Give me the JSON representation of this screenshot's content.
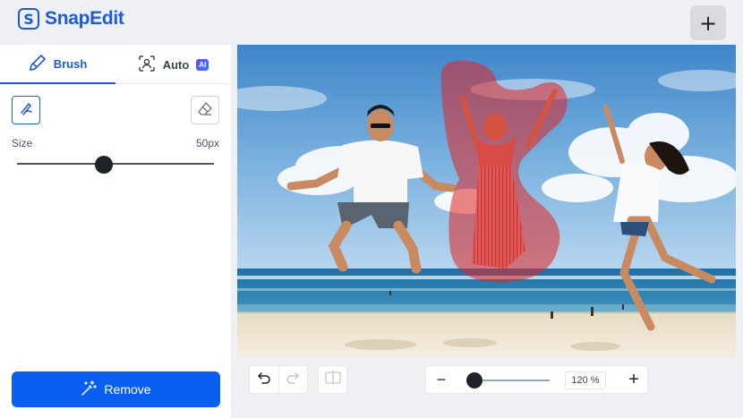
{
  "app": {
    "logo_letter": "S",
    "name": "SnapEdit",
    "add_label": "+"
  },
  "tabs": [
    {
      "label": "Brush",
      "icon": "brush-icon",
      "active": true
    },
    {
      "label": "Auto",
      "icon": "person-scan-icon",
      "badge": "AI"
    }
  ],
  "brush": {
    "tools": [
      {
        "name": "brush-tool",
        "icon": "brush-icon",
        "selected": true
      },
      {
        "name": "eraser-tool",
        "icon": "eraser-icon",
        "selected": false
      }
    ],
    "size_label": "Size",
    "size_value": "50px",
    "size_fraction": 0.44
  },
  "remove_button": {
    "label": "Remove",
    "icon": "magic-wand-icon"
  },
  "toolbar": {
    "undo_icon": "undo-icon",
    "redo_icon": "redo-icon",
    "compare_icon": "compare-icon",
    "zoom_minus": "−",
    "zoom_plus": "+",
    "zoom_value": "120 %",
    "zoom_fraction": 0.0
  },
  "colors": {
    "brand": "#1d5bd8",
    "remove_button": "#0b5ff0",
    "mask": "#e02424"
  }
}
